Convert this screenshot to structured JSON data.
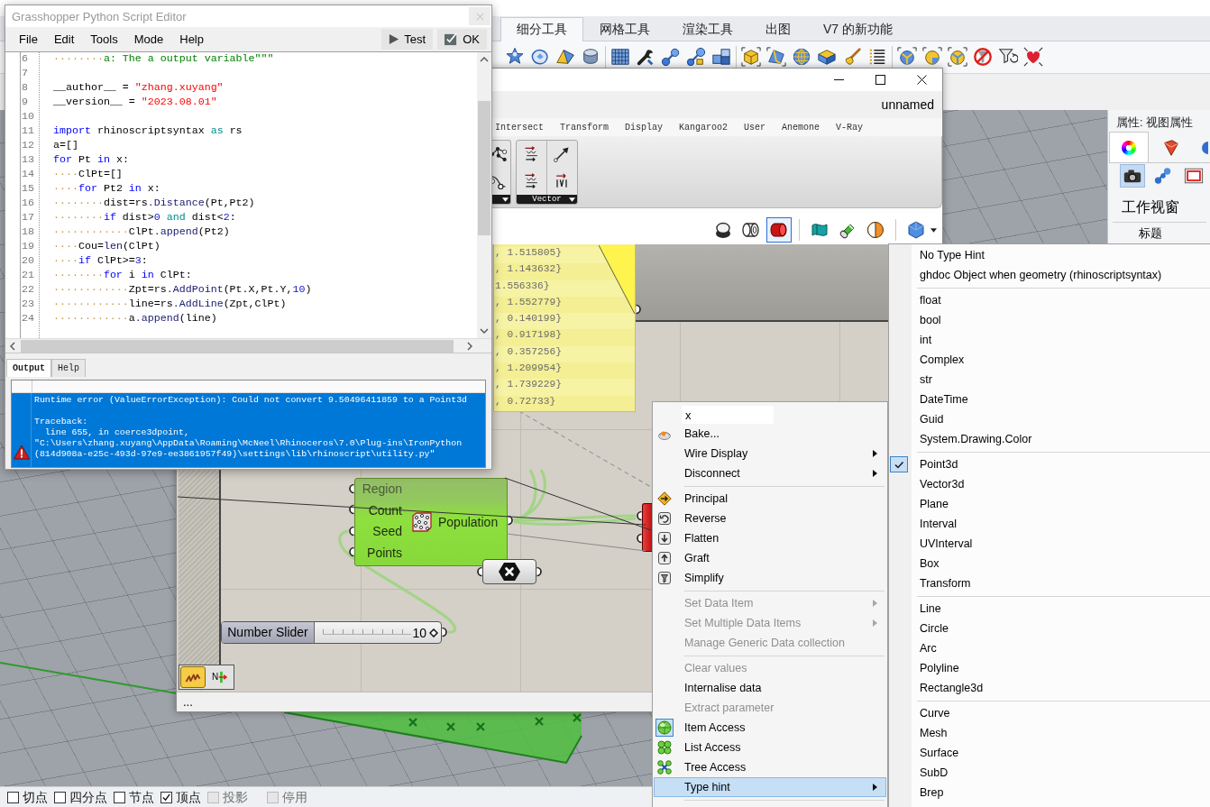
{
  "rhino": {
    "ribbon_tabs": [
      {
        "label": "细分工具",
        "selected": true
      },
      {
        "label": "网格工具",
        "selected": false
      },
      {
        "label": "渲染工具",
        "selected": false
      },
      {
        "label": "出图",
        "selected": false
      },
      {
        "label": "V7 的新功能",
        "selected": false
      }
    ],
    "properties": {
      "title": "属性: 视图属性",
      "tabs": [
        {
          "selected": true
        },
        {
          "selected": false
        },
        {
          "selected": false
        }
      ],
      "view_buttons": [
        {
          "selected": true
        },
        {
          "selected": false
        },
        {
          "selected": false
        }
      ],
      "section": "工作视窗",
      "field_label": "标题"
    },
    "osnaps": [
      {
        "label": "切点",
        "checked": false,
        "disabled": false
      },
      {
        "label": "四分点",
        "checked": false,
        "disabled": false
      },
      {
        "label": "节点",
        "checked": false,
        "disabled": false
      },
      {
        "label": "顶点",
        "checked": true,
        "disabled": false
      },
      {
        "label": "投影",
        "checked": false,
        "disabled": true
      },
      {
        "label": "停用",
        "checked": false,
        "disabled": true
      }
    ]
  },
  "grasshopper": {
    "document": "unnamed",
    "tabs": [
      "Intersect",
      "Transform",
      "Display",
      "Kangaroo2",
      "User",
      "Anemone",
      "V-Ray"
    ],
    "component_group": "Vector",
    "preview_modes": [
      {
        "selected": false
      },
      {
        "selected": false
      },
      {
        "selected": true
      }
    ],
    "panel_values": [
      ", 1.515805}",
      ", 1.143632}",
      "1.556336}",
      ", 1.552779}",
      ", 0.140199}",
      ", 0.917198}",
      ", 0.357256}",
      ", 1.209954}",
      ", 1.739229}",
      ", 0.72733}"
    ],
    "component": {
      "inputs": [
        "Region",
        "Count",
        "Seed",
        "Points"
      ],
      "output": "Population"
    },
    "slider": {
      "label": "Number Slider",
      "value": "10",
      "level": 1
    },
    "canvas_toggles": [
      {
        "on": true
      },
      {
        "on": false,
        "label": "N"
      }
    ],
    "status": "..."
  },
  "script_editor": {
    "title": "Grasshopper Python Script Editor",
    "menu": [
      "File",
      "Edit",
      "Tools",
      "Mode",
      "Help"
    ],
    "buttons": [
      "Test",
      "OK"
    ],
    "code_lines": [
      {
        "number": "6",
        "tokens": [
          {
            "kind": "space_marks",
            "text": "········"
          },
          {
            "kind": "docstring",
            "text": "a: The a output variable\"\"\""
          }
        ]
      },
      {
        "number": "7"
      },
      {
        "number": "8",
        "tokens": [
          {
            "kind": "plain",
            "text": "__author__ = "
          },
          {
            "kind": "string",
            "text": "\"zhang.xuyang\""
          }
        ]
      },
      {
        "number": "9",
        "tokens": [
          {
            "kind": "plain",
            "text": "__version__ = "
          },
          {
            "kind": "string",
            "text": "\"2023.08.01\""
          }
        ]
      },
      {
        "number": "10"
      },
      {
        "number": "11",
        "tokens": [
          {
            "kind": "keyword",
            "text": "import"
          },
          {
            "kind": "plain",
            "text": " rhinoscriptsyntax "
          },
          {
            "kind": "operator_word",
            "text": "as"
          },
          {
            "kind": "plain",
            "text": " rs"
          }
        ]
      },
      {
        "number": "12",
        "tokens": [
          {
            "kind": "plain",
            "text": "a=[]"
          }
        ]
      },
      {
        "number": "13",
        "tokens": [
          {
            "kind": "keyword",
            "text": "for"
          },
          {
            "kind": "plain",
            "text": " Pt "
          },
          {
            "kind": "keyword",
            "text": "in"
          },
          {
            "kind": "plain",
            "text": " x:"
          }
        ]
      },
      {
        "number": "14",
        "tokens": [
          {
            "kind": "space_marks",
            "text": "····"
          },
          {
            "kind": "plain",
            "text": "ClPt=[]"
          }
        ]
      },
      {
        "number": "15",
        "tokens": [
          {
            "kind": "space_marks",
            "text": "····"
          },
          {
            "kind": "keyword",
            "text": "for"
          },
          {
            "kind": "plain",
            "text": " Pt2 "
          },
          {
            "kind": "keyword",
            "text": "in"
          },
          {
            "kind": "plain",
            "text": " x:"
          }
        ]
      },
      {
        "number": "16",
        "tokens": [
          {
            "kind": "space_marks",
            "text": "········"
          },
          {
            "kind": "plain",
            "text": "dist=rs"
          },
          {
            "kind": "member",
            "text": ".Distance"
          },
          {
            "kind": "plain",
            "text": "(Pt,Pt2)"
          }
        ]
      },
      {
        "number": "17",
        "tokens": [
          {
            "kind": "space_marks",
            "text": "········"
          },
          {
            "kind": "keyword",
            "text": "if"
          },
          {
            "kind": "plain",
            "text": " dist>"
          },
          {
            "kind": "number",
            "text": "0"
          },
          {
            "kind": "operator_word",
            "text": " and"
          },
          {
            "kind": "plain",
            "text": " dist<"
          },
          {
            "kind": "number",
            "text": "2"
          },
          {
            "kind": "plain",
            "text": ":"
          }
        ]
      },
      {
        "number": "18",
        "tokens": [
          {
            "kind": "space_marks",
            "text": "············"
          },
          {
            "kind": "plain",
            "text": "ClPt"
          },
          {
            "kind": "member",
            "text": ".append"
          },
          {
            "kind": "plain",
            "text": "(Pt2)"
          }
        ]
      },
      {
        "number": "19",
        "tokens": [
          {
            "kind": "space_marks",
            "text": "····"
          },
          {
            "kind": "plain",
            "text": "Cou="
          },
          {
            "kind": "member",
            "text": "len"
          },
          {
            "kind": "plain",
            "text": "(ClPt)"
          }
        ]
      },
      {
        "number": "20",
        "tokens": [
          {
            "kind": "space_marks",
            "text": "····"
          },
          {
            "kind": "keyword",
            "text": "if"
          },
          {
            "kind": "plain",
            "text": " ClPt>="
          },
          {
            "kind": "number",
            "text": "3"
          },
          {
            "kind": "plain",
            "text": ":"
          }
        ]
      },
      {
        "number": "21",
        "tokens": [
          {
            "kind": "space_marks",
            "text": "········"
          },
          {
            "kind": "keyword",
            "text": "for"
          },
          {
            "kind": "plain",
            "text": " i "
          },
          {
            "kind": "keyword",
            "text": "in"
          },
          {
            "kind": "plain",
            "text": " ClPt:"
          }
        ]
      },
      {
        "number": "22",
        "tokens": [
          {
            "kind": "space_marks",
            "text": "············"
          },
          {
            "kind": "plain",
            "text": "Zpt=rs"
          },
          {
            "kind": "member",
            "text": ".AddPoint"
          },
          {
            "kind": "plain",
            "text": "(Pt.X,Pt.Y,"
          },
          {
            "kind": "number",
            "text": "10"
          },
          {
            "kind": "plain",
            "text": ")"
          }
        ]
      },
      {
        "number": "23",
        "tokens": [
          {
            "kind": "space_marks",
            "text": "············"
          },
          {
            "kind": "plain",
            "text": "line=rs"
          },
          {
            "kind": "member",
            "text": ".AddLine"
          },
          {
            "kind": "plain",
            "text": "(Zpt,ClPt)"
          }
        ]
      },
      {
        "number": "24",
        "tokens": [
          {
            "kind": "space_marks",
            "text": "············"
          },
          {
            "kind": "plain",
            "text": "a"
          },
          {
            "kind": "member",
            "text": ".append"
          },
          {
            "kind": "plain",
            "text": "(line)"
          }
        ]
      }
    ],
    "output_tabs": [
      {
        "label": "Output",
        "selected": true
      },
      {
        "label": "Help",
        "selected": false
      }
    ],
    "output_rows": [
      {
        "selected": true,
        "paragraphs": [
          [
            "Runtime error (ValueErrorException): Could not convert 9.50496411859 to a Point3d"
          ],
          [
            "Traceback:",
            "  line 655, in coerce3dpoint,",
            "\"C:\\Users\\zhang.xuyang\\AppData\\Roaming\\McNeel\\Rhinoceros\\7.0\\Plug-ins\\IronPython",
            "(814d908a-e25c-493d-97e9-ee3861957f49)\\settings\\lib\\rhinoscript\\utility.py\""
          ]
        ]
      }
    ]
  },
  "context_menu": {
    "name_field": {
      "value": "x"
    },
    "sections": [
      [
        {
          "label": "Bake...",
          "disabled": false,
          "submenu": false,
          "checked": false,
          "selected": false
        },
        {
          "label": "Wire Display",
          "disabled": false,
          "submenu": true,
          "checked": false,
          "selected": false
        },
        {
          "label": "Disconnect",
          "disabled": false,
          "submenu": true,
          "checked": false,
          "selected": false
        }
      ],
      [
        {
          "label": "Principal",
          "disabled": false,
          "submenu": false,
          "checked": false,
          "selected": false
        },
        {
          "label": "Reverse",
          "disabled": false,
          "submenu": false,
          "checked": false,
          "selected": false
        },
        {
          "label": "Flatten",
          "disabled": false,
          "submenu": false,
          "checked": false,
          "selected": false
        },
        {
          "label": "Graft",
          "disabled": false,
          "submenu": false,
          "checked": false,
          "selected": false
        },
        {
          "label": "Simplify",
          "disabled": false,
          "submenu": false,
          "checked": false,
          "selected": false
        }
      ],
      [
        {
          "label": "Set Data Item",
          "disabled": true,
          "submenu": true,
          "checked": false,
          "selected": false
        },
        {
          "label": "Set Multiple Data Items",
          "disabled": true,
          "submenu": true,
          "checked": false,
          "selected": false
        },
        {
          "label": "Manage Generic Data collection",
          "disabled": true,
          "submenu": false,
          "checked": false,
          "selected": false
        }
      ],
      [
        {
          "label": "Clear values",
          "disabled": true,
          "submenu": false,
          "checked": false,
          "selected": false
        },
        {
          "label": "Internalise data",
          "disabled": false,
          "submenu": false,
          "checked": false,
          "selected": false
        },
        {
          "label": "Extract parameter",
          "disabled": true,
          "submenu": false,
          "checked": false,
          "selected": false
        },
        {
          "label": "Item Access",
          "disabled": false,
          "submenu": false,
          "checked": true,
          "selected": false
        },
        {
          "label": "List Access",
          "disabled": false,
          "submenu": false,
          "checked": false,
          "selected": false
        },
        {
          "label": "Tree Access",
          "disabled": false,
          "submenu": false,
          "checked": false,
          "selected": false
        },
        {
          "label": "Type hint",
          "disabled": false,
          "submenu": true,
          "checked": false,
          "selected": true
        }
      ]
    ]
  },
  "type_hint_menu": {
    "sections": [
      [
        {
          "label": "No Type Hint",
          "checked": false
        },
        {
          "label": "ghdoc Object when geometry (rhinoscriptsyntax)",
          "checked": false
        }
      ],
      [
        {
          "label": "float",
          "checked": false
        },
        {
          "label": "bool",
          "checked": false
        },
        {
          "label": "int",
          "checked": false
        },
        {
          "label": "Complex",
          "checked": false
        },
        {
          "label": "str",
          "checked": false
        },
        {
          "label": "DateTime",
          "checked": false
        },
        {
          "label": "Guid",
          "checked": false
        },
        {
          "label": "System.Drawing.Color",
          "checked": false
        }
      ],
      [
        {
          "label": "Point3d",
          "checked": true
        },
        {
          "label": "Vector3d",
          "checked": false
        },
        {
          "label": "Plane",
          "checked": false
        },
        {
          "label": "Interval",
          "checked": false
        },
        {
          "label": "UVInterval",
          "checked": false
        },
        {
          "label": "Box",
          "checked": false
        },
        {
          "label": "Transform",
          "checked": false
        }
      ],
      [
        {
          "label": "Line",
          "checked": false
        },
        {
          "label": "Circle",
          "checked": false
        },
        {
          "label": "Arc",
          "checked": false
        },
        {
          "label": "Polyline",
          "checked": false
        },
        {
          "label": "Rectangle3d",
          "checked": false
        }
      ],
      [
        {
          "label": "Curve",
          "checked": false
        },
        {
          "label": "Mesh",
          "checked": false
        },
        {
          "label": "Surface",
          "checked": false
        },
        {
          "label": "SubD",
          "checked": false
        },
        {
          "label": "Brep",
          "checked": false
        }
      ]
    ]
  }
}
